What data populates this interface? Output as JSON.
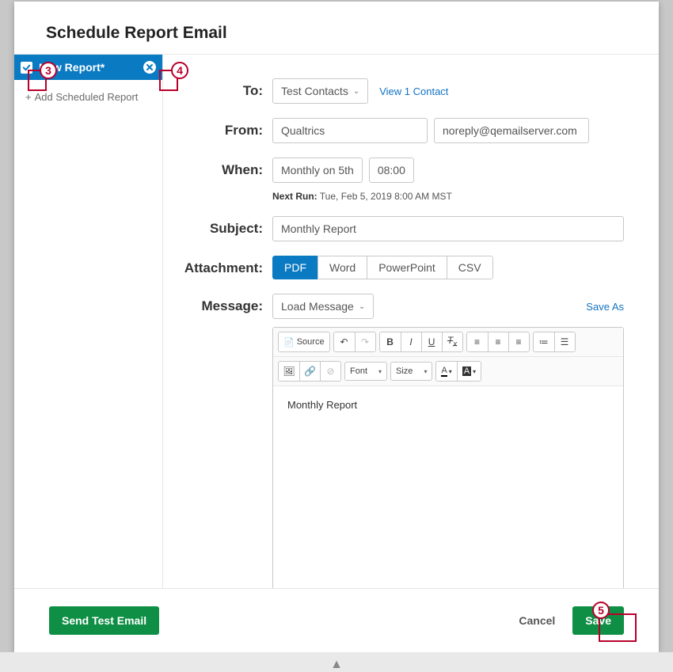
{
  "header": {
    "title": "Schedule Report Email"
  },
  "sidebar": {
    "report_name": "New Report*",
    "add_label": "Add Scheduled Report"
  },
  "form": {
    "to_label": "To:",
    "to_value": "Test Contacts",
    "view_contacts": "View 1 Contact",
    "from_label": "From:",
    "from_name": "Qualtrics",
    "from_email": "noreply@qemailserver.com",
    "when_label": "When:",
    "when_freq": "Monthly on 5th",
    "when_time": "08:00",
    "next_run_label": "Next Run:",
    "next_run_value": "Tue, Feb 5, 2019 8:00 AM MST",
    "subject_label": "Subject:",
    "subject_value": "Monthly Report",
    "attachment_label": "Attachment:",
    "attachments": [
      "PDF",
      "Word",
      "PowerPoint",
      "CSV"
    ],
    "message_label": "Message:",
    "load_message_label": "Load Message",
    "save_as": "Save As",
    "toolbar": {
      "source": "Source",
      "font": "Font",
      "size": "Size"
    },
    "editor_body": "Monthly Report"
  },
  "footer": {
    "send_test": "Send Test Email",
    "cancel": "Cancel",
    "save": "Save"
  },
  "annotations": {
    "c3": "3",
    "c4": "4",
    "c5": "5"
  }
}
